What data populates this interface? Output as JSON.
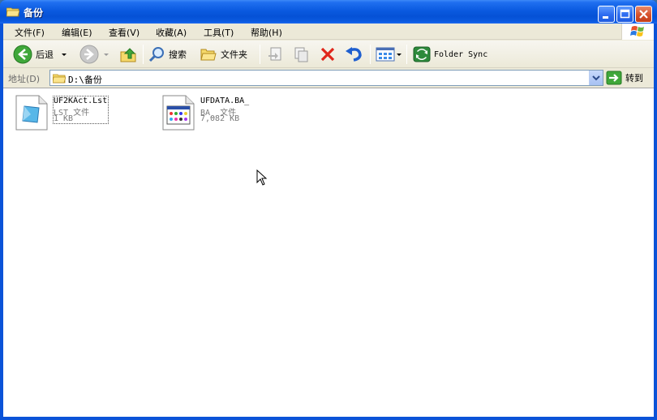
{
  "window": {
    "title": "备份"
  },
  "menu": [
    {
      "label": "文件(F)"
    },
    {
      "label": "编辑(E)"
    },
    {
      "label": "查看(V)"
    },
    {
      "label": "收藏(A)"
    },
    {
      "label": "工具(T)"
    },
    {
      "label": "帮助(H)"
    }
  ],
  "toolbar": {
    "back_label": "后退",
    "search_label": "搜索",
    "folders_label": "文件夹",
    "folder_sync_label": "Folder Sync"
  },
  "address": {
    "label": "地址(D)",
    "value": "D:\\备份",
    "go_label": "转到"
  },
  "files": [
    {
      "name": "UF2KAct.Lst",
      "type": "LST 文件",
      "size": "1 KB",
      "icon": "document-icon"
    },
    {
      "name": "UFDATA.BA_",
      "type": "BA_ 文件",
      "size": "7,082 KB",
      "icon": "application-icon"
    }
  ],
  "colors": {
    "titlebar": "#0a5ae0",
    "chrome": "#ece9d8",
    "close": "#d7512b"
  }
}
